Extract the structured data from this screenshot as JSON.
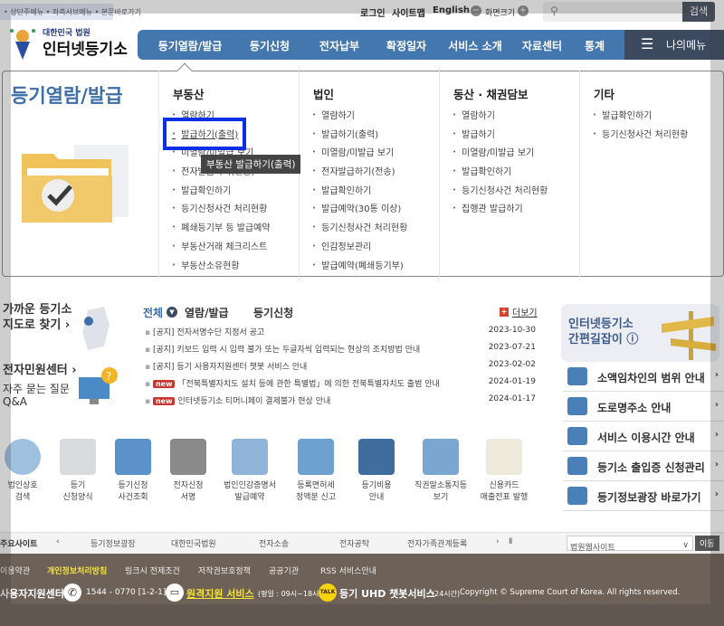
{
  "skip_links": "• 상단주메뉴 • 좌측서브메뉴 • 본문바로가기",
  "util": {
    "login": "로그인",
    "sitemap": "사이트맵",
    "english": "English",
    "font_size": "화면크기",
    "minus": "−",
    "plus": "+",
    "search_button": "검색"
  },
  "logo": {
    "line1": "대한민국 법원",
    "line2": "인터넷등기소"
  },
  "nav": {
    "items": [
      "등기열람/발급",
      "등기신청",
      "전자납부",
      "확정일자",
      "서비스 소개",
      "자료센터",
      "통계"
    ],
    "my_menu": "나의메뉴",
    "accent": "#4477ae"
  },
  "mega": {
    "title": "등기열람/발급",
    "columns": [
      {
        "heading": "부동산",
        "items": [
          "열람하기",
          "발급하기(출력)",
          "미열람/미발급 보기",
          "전자발급하기(전송)",
          "발급확인하기",
          "등기신청사건 처리현황",
          "폐쇄등기부 등 발급예약",
          "부동산거래 체크리스트",
          "부동산소유현황"
        ]
      },
      {
        "heading": "법인",
        "items": [
          "열람하기",
          "발급하기(출력)",
          "미열람/미발급 보기",
          "전자발급하기(전송)",
          "발급확인하기",
          "발급예약(30통 이상)",
          "등기신청사건 처리현황",
          "인감정보관리",
          "발급예약(폐쇄등기부)"
        ]
      },
      {
        "heading": "동산 · 채권담보",
        "items": [
          "열람하기",
          "발급하기",
          "미열람/미발급 보기",
          "발급확인하기",
          "등기신청사건 처리현황",
          "집행관 발급하기"
        ]
      },
      {
        "heading": "기타",
        "items": [
          "발급확인하기",
          "등기신청사건 처리현황"
        ]
      }
    ],
    "tooltip": "부동산 발급하기(출력)"
  },
  "side": {
    "map1": "가까운 등기소",
    "map2": "지도로 찾기 ›",
    "center": "전자민원센터 ›",
    "faq1": "자주 묻는 질문",
    "faq2": "Q&A"
  },
  "notice": {
    "tabs": [
      "전체",
      "열람/발급",
      "등기신청"
    ],
    "more": "더보기",
    "new_label": "new",
    "rows": [
      {
        "title": "[공지] 전자서명수단 지정서 공고",
        "date": "2023-10-30"
      },
      {
        "title": "[공지] 키보드 입력 시 입력 불가 또는 두글자씩 입력되는 현상의 조치방법 안내",
        "date": "2023-07-21"
      },
      {
        "title": "[공지] 등기 사용자지원센터 챗봇 서비스 안내",
        "date": "2023-02-02"
      },
      {
        "title": "「전북특별자치도 설치 등에 관한 특별법」에 의한 전북특별자치도 출범 안내",
        "date": "2024-01-19"
      },
      {
        "title": "인터넷등기소 티머니페이 결제불가 현상 안내",
        "date": "2024-01-17"
      }
    ]
  },
  "banner": {
    "line1": "인터넷등기소",
    "line2": "간편길잡이 ⓘ"
  },
  "quick": [
    "소액임차인의 범위 안내",
    "도로명주소 안내",
    "서비스 이용시간 안내",
    "등기소 출입증 신청관리",
    "등기정보광장 바로가기"
  ],
  "icons": [
    [
      "법인상호",
      "검색"
    ],
    [
      "등기",
      "신청양식"
    ],
    [
      "등기신청",
      "사건조회"
    ],
    [
      "전자신청",
      "서명"
    ],
    [
      "법인인감증명서",
      "발급예약"
    ],
    [
      "등록면허세",
      "정액분 신고"
    ],
    [
      "등기비용",
      "안내"
    ],
    [
      "직권말소통지등",
      "보기"
    ],
    [
      "신용카드",
      "매출전표 발행"
    ]
  ],
  "sites": {
    "label": "주요사이트",
    "items": [
      "등기정보광장",
      "대한민국법원",
      "전자소송",
      "전자공탁",
      "전자가족관계등록"
    ],
    "select": "법원웹사이트",
    "go": "이동"
  },
  "footer": {
    "links": [
      "이용약관",
      "개인정보처리방침",
      "링크시 전제조건",
      "저작권보호정책",
      "공공기관",
      "RSS 서비스안내"
    ],
    "support": "사용자지원센터",
    "phone": "1544 - 0770 [1-2-1]",
    "remote": "원격지원 서비스",
    "remote_hours": "(평일 : 09시~18시)",
    "chatbot": "등기 UHD 챗봇서비스",
    "chatbot_hours": "(24시간)",
    "copyright": "Copyright © Supreme Court of Korea. All rights reserved."
  }
}
